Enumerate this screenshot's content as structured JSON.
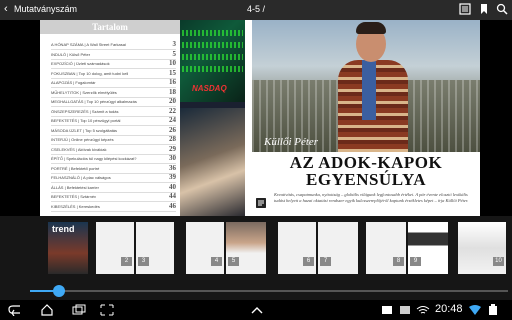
{
  "topbar": {
    "back_glyph": "‹",
    "title": "Mutatványszám",
    "page_indicator": "4-5 /",
    "icons": [
      "toc-icon",
      "bookmark-icon",
      "search-icon"
    ]
  },
  "toc": {
    "heading": "Tartalom",
    "rows": [
      {
        "text": "A HÓNAP SZÁMA | A Wall Street Farkasai",
        "num": "3"
      },
      {
        "text": "INDULÓ | Külső Péter",
        "num": "5"
      },
      {
        "text": "EXPOZÍCIÓ | Üzleti számadások",
        "num": "10"
      },
      {
        "text": "FOKUSZBAN | Top 10 dolog, amit tudni kell",
        "num": "15"
      },
      {
        "text": "ALAPOZÁS | Fogalomtár",
        "num": "16"
      },
      {
        "text": "MŰHELYTITOK | Szerzők elmélyülés",
        "num": "18"
      },
      {
        "text": "MEGHALLGATÁS | Top 10 pénzügyi alkalmazás",
        "num": "20"
      },
      {
        "text": "ÖNSZEPSZEREZÉS | Számít a tudás",
        "num": "22"
      },
      {
        "text": "BEFEKTETÉS | Top 10 pénzügyi portál",
        "num": "24"
      },
      {
        "text": "MÁSODA ÜZLET | Top 5 szolgáltatás",
        "num": "26"
      },
      {
        "text": "INTERJÚ | Online pénzügyi képzés",
        "num": "28"
      },
      {
        "text": "CSELEKVÉS | Aktívak kiválóak",
        "num": "29"
      },
      {
        "text": "ÉPÍTŐ | Spekulációs túl nagy kilépési kockázat?",
        "num": "30"
      },
      {
        "text": "PORTRÉ | Befektető portré",
        "num": "36"
      },
      {
        "text": "FELHASZNÁLÓ | A piac válságos",
        "num": "39"
      },
      {
        "text": "ÁLLÁS | Befektetési karrier",
        "num": "40"
      },
      {
        "text": "BEFEKTETÉS | Sztárnév",
        "num": "44"
      },
      {
        "text": "KIBESZÉLÉS | Kereskedés",
        "num": "46"
      }
    ]
  },
  "article": {
    "byline": "Küllői Péter",
    "headline_line1": "AZ ADOK-KAPOK",
    "headline_line2": "EGYENSÚLYA",
    "lead": "Kreativitás, csapatmunka, nyitottság – globális világunk legfontosabb értékei. A pár évente elosztó lexikális tudást helyett a hazai oktatási rendszer egyik kulcsszereplőjéről kaptunk érzékletes képet – írja Küllői Péter."
  },
  "photos": {
    "nasdaq": "NASDAQ"
  },
  "thumbnails": [
    {
      "label": "trend",
      "num": ""
    },
    {
      "label": "",
      "num": "2"
    },
    {
      "label": "",
      "num": "3"
    },
    {
      "label": "",
      "num": "4"
    },
    {
      "label": "",
      "num": "5"
    },
    {
      "label": "",
      "num": "6"
    },
    {
      "label": "",
      "num": "7"
    },
    {
      "label": "",
      "num": "8"
    },
    {
      "label": "",
      "num": "9"
    },
    {
      "label": "",
      "num": "10"
    }
  ],
  "slider": {
    "position_fraction": 0.06
  },
  "statusbar": {
    "time": "20:48"
  },
  "colors": {
    "accent": "#3fa9f5",
    "topbar": "#2a2a2a"
  }
}
